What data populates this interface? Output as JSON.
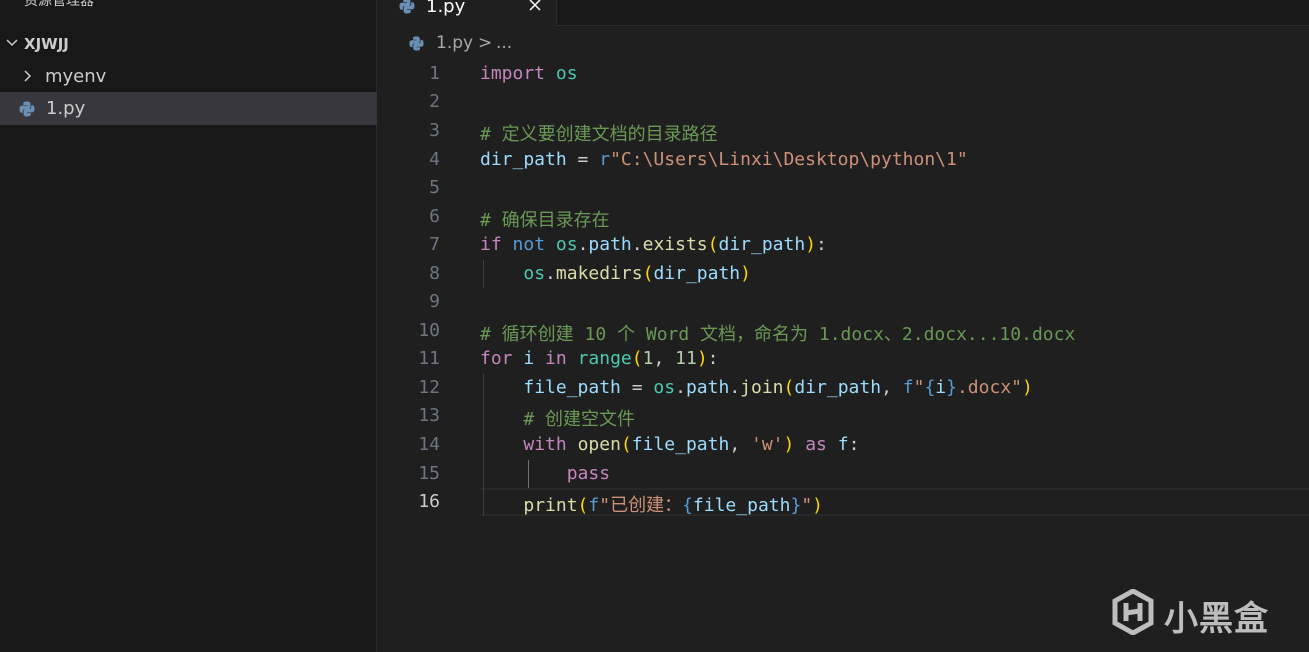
{
  "sidebar": {
    "title": "资源管理器",
    "root_label": "XJWJJ",
    "items": [
      {
        "label": "myenv"
      },
      {
        "label": "1.py"
      }
    ]
  },
  "tab": {
    "label": "1.py"
  },
  "breadcrumb": {
    "file": "1.py",
    "separator": ">",
    "more": "..."
  },
  "code": {
    "line_numbers": [
      "1",
      "2",
      "3",
      "4",
      "5",
      "6",
      "7",
      "8",
      "9",
      "10",
      "11",
      "12",
      "13",
      "14",
      "15",
      "16"
    ],
    "active_line": "16"
  },
  "watermark": {
    "text": "小黑盒"
  },
  "colors": {
    "keyword_control": "#c586c0",
    "keyword": "#569cd6",
    "module": "#4ec9b0",
    "variable": "#9cdcfe",
    "function": "#dcdcaa",
    "string": "#ce9178",
    "number": "#b5cea8",
    "comment": "#6a9955"
  }
}
